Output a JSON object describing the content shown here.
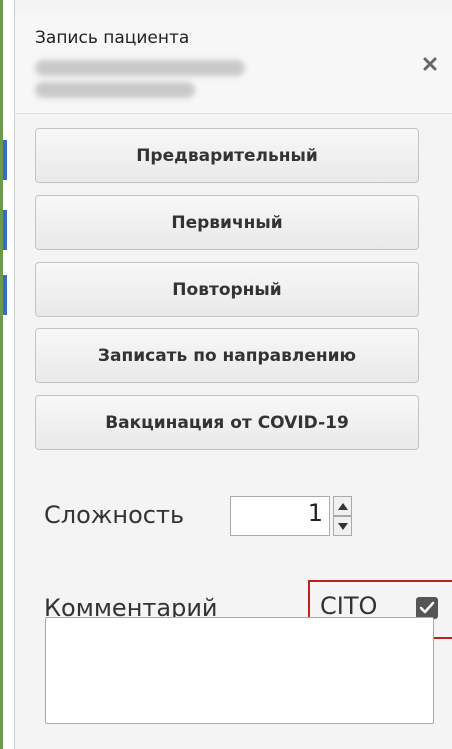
{
  "dialog": {
    "title": "Запись пациента"
  },
  "buttons": {
    "preliminary": "Предварительный",
    "primary": "Первичный",
    "repeat": "Повторный",
    "by_referral": "Записать по направлению",
    "covid_vaccination": "Вакцинация от COVID-19"
  },
  "complexity": {
    "label": "Сложность",
    "value": "1"
  },
  "comment": {
    "label": "Комментарий",
    "value": ""
  },
  "cito": {
    "label": "CITO",
    "checked": true
  },
  "colors": {
    "highlight": "#c0201c",
    "strip_green": "#5a8a3a",
    "strip_blue": "#3a6ac8"
  },
  "icons": {
    "close": "close-icon",
    "spin_up": "spin-up-icon",
    "spin_down": "spin-down-icon",
    "checkmark": "checkmark-icon"
  }
}
